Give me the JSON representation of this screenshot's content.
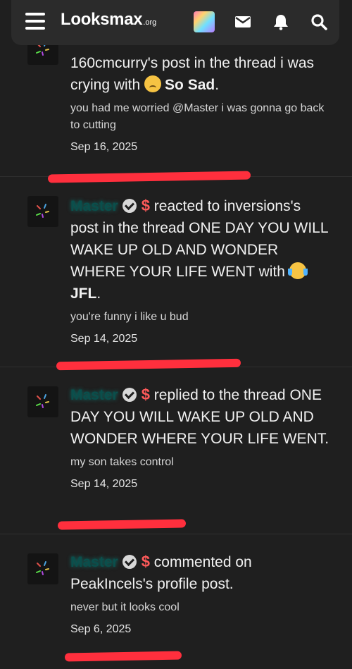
{
  "header": {
    "logo_main": "Looksmax",
    "logo_suffix": ".org",
    "icons": [
      "menu-icon",
      "avatar",
      "mail-icon",
      "bell-icon",
      "search-icon"
    ]
  },
  "feed": [
    {
      "title_text": "160cmcurry's post in the thread i was crying with",
      "reaction_label": "So Sad",
      "title_tail": ".",
      "snippet": "you had me worried @Master i was gonna go back to cutting",
      "date": "Sep 16, 2025"
    },
    {
      "user": "Master",
      "badge": "$",
      "action": "reacted to",
      "title_text": "inversions's post in the thread ONE DAY YOU WILL WAKE UP OLD AND WONDER WHERE YOUR LIFE WENT with",
      "reaction_label": "JFL",
      "title_tail": ".",
      "snippet": "you're funny i like u bud",
      "date": "Sep 14, 2025"
    },
    {
      "user": "Master",
      "badge": "$",
      "action": "replied to the thread",
      "title_text": "ONE DAY YOU WILL WAKE UP OLD AND WONDER WHERE YOUR LIFE WENT.",
      "snippet": "my son takes control",
      "date": "Sep 14, 2025"
    },
    {
      "user": "Master",
      "badge": "$",
      "action": "commented on",
      "title_text": "PeakIncels's profile post.",
      "snippet": "never but it looks cool",
      "date": "Sep 6, 2025"
    }
  ],
  "colors": {
    "background": "#1f1f1f",
    "header": "#2b2b2b",
    "username": "#0a4f4c",
    "dollar": "#ff5a5a",
    "redaction": "#ff2f3d"
  }
}
